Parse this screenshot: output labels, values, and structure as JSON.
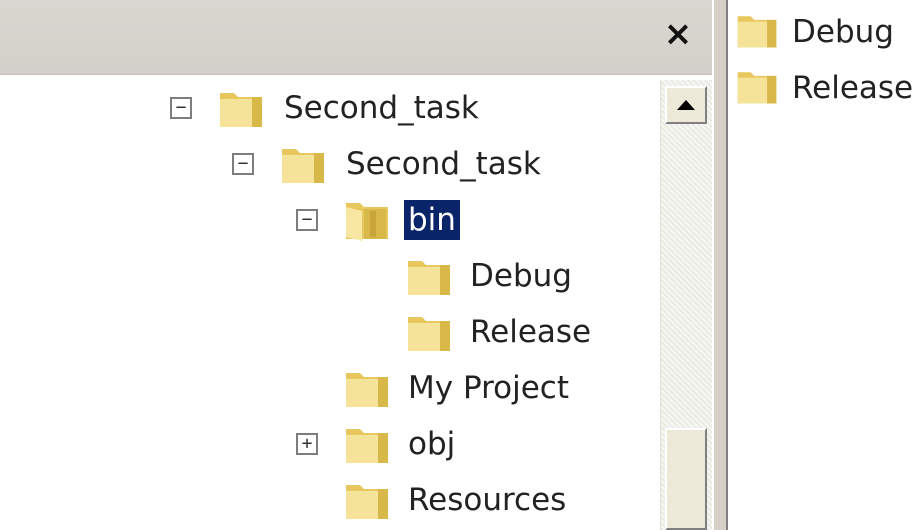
{
  "left_pane": {
    "close_glyph": "×",
    "tree": [
      {
        "label": "Second_task",
        "expander": "−",
        "icon": "folder-icon",
        "selected": false
      },
      {
        "label": "Second_task",
        "expander": "−",
        "icon": "folder-icon",
        "selected": false
      },
      {
        "label": "bin",
        "expander": "−",
        "icon": "folder-open-icon",
        "selected": true
      },
      {
        "label": "Debug",
        "expander": "",
        "icon": "folder-icon",
        "selected": false
      },
      {
        "label": "Release",
        "expander": "",
        "icon": "folder-icon",
        "selected": false
      },
      {
        "label": "My Project",
        "expander": "",
        "icon": "folder-icon",
        "selected": false
      },
      {
        "label": "obj",
        "expander": "+",
        "icon": "folder-icon",
        "selected": false
      },
      {
        "label": "Resources",
        "expander": "",
        "icon": "folder-icon",
        "selected": false
      }
    ]
  },
  "right_pane": {
    "items": [
      {
        "label": "Debug",
        "icon": "folder-icon"
      },
      {
        "label": "Release",
        "icon": "folder-icon"
      }
    ]
  },
  "colors": {
    "selection": "#0a246a",
    "folder": "#f3dc84"
  }
}
